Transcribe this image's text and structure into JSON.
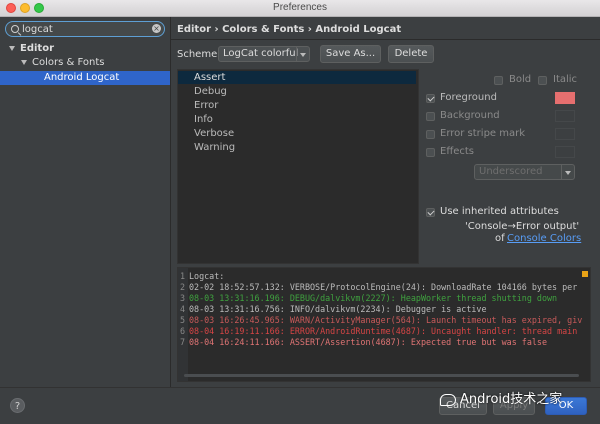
{
  "window": {
    "title": "Preferences"
  },
  "search": {
    "value": "logcat"
  },
  "tree": [
    {
      "label": "Editor"
    },
    {
      "label": "Colors & Fonts"
    },
    {
      "label": "Android Logcat"
    }
  ],
  "breadcrumb": "Editor › Colors & Fonts › Android Logcat",
  "scheme": {
    "label": "Scheme:",
    "value": "LogCat colorful",
    "save_as": "Save As...",
    "delete": "Delete"
  },
  "levels": [
    "Assert",
    "Debug",
    "Error",
    "Info",
    "Verbose",
    "Warning"
  ],
  "options": {
    "bold": "Bold",
    "italic": "Italic",
    "foreground": "Foreground",
    "background": "Background",
    "error_stripe": "Error stripe mark",
    "effects": "Effects",
    "effects_value": "Underscored",
    "inherited": "Use inherited attributes",
    "inherit_from": "'Console→Error output'",
    "inherit_of": "of",
    "inherit_link": "Console Colors",
    "foreground_color": "#e66f6f"
  },
  "preview": [
    {
      "no": "1",
      "text": "Logcat:",
      "color": "#bbbbbb"
    },
    {
      "no": "2",
      "text": "02-02 18:52:57.132: VERBOSE/ProtocolEngine(24): DownloadRate 104166 bytes per",
      "color": "#bbbbbb"
    },
    {
      "no": "3",
      "text": "08-03 13:31:16.196: DEBUG/dalvikvm(2227): HeapWorker thread shutting down",
      "color": "#3fa23f"
    },
    {
      "no": "4",
      "text": "08-03 13:31:16.756: INFO/dalvikvm(2234): Debugger is active",
      "color": "#bbbbbb"
    },
    {
      "no": "5",
      "text": "08-03 16:26:45.965: WARN/ActivityManager(564): Launch timeout has expired, giv",
      "color": "#c85a5a"
    },
    {
      "no": "6",
      "text": "08-04 16:19:11.166: ERROR/AndroidRuntime(4687): Uncaught handler: thread main",
      "color": "#d64545"
    },
    {
      "no": "7",
      "text": "08-04 16:24:11.166: ASSERT/Assertion(4687): Expected true but was false",
      "color": "#e07474"
    }
  ],
  "buttons": {
    "cancel": "Cancel",
    "apply": "Apply",
    "ok": "OK"
  },
  "help": "?",
  "watermark": "Android技术之家"
}
